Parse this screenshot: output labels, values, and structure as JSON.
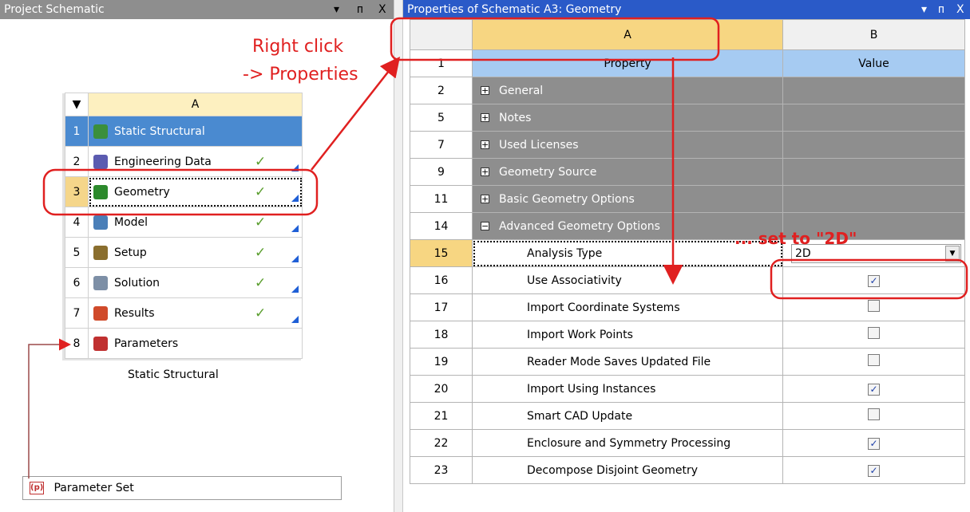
{
  "left_pane": {
    "title": "Project Schematic",
    "controls": {
      "menu": "▾",
      "pin": "ᴨ",
      "close": "X"
    },
    "system": {
      "dropdown_glyph": "▼",
      "column_header": "A",
      "caption": "Static Structural",
      "rows": [
        {
          "num": "1",
          "label": "Static Structural",
          "icon": "static-structural-icon",
          "icon_color": "#3b8f3b",
          "check": "",
          "corner": false
        },
        {
          "num": "2",
          "label": "Engineering Data",
          "icon": "engineering-data-icon",
          "icon_color": "#5b5bb0",
          "check": "✓",
          "corner": true
        },
        {
          "num": "3",
          "label": "Geometry",
          "icon": "geometry-dm-icon",
          "icon_color": "#2c8a2c",
          "check": "✓",
          "corner": true
        },
        {
          "num": "4",
          "label": "Model",
          "icon": "model-icon",
          "icon_color": "#4a7fb8",
          "check": "✓",
          "corner": true
        },
        {
          "num": "5",
          "label": "Setup",
          "icon": "setup-icon",
          "icon_color": "#8a6e2e",
          "check": "✓",
          "corner": true
        },
        {
          "num": "6",
          "label": "Solution",
          "icon": "solution-icon",
          "icon_color": "#7d8fa6",
          "check": "✓",
          "corner": true
        },
        {
          "num": "7",
          "label": "Results",
          "icon": "results-icon",
          "icon_color": "#d04a2a",
          "check": "✓",
          "corner": true
        },
        {
          "num": "8",
          "label": "Parameters",
          "icon": "parameters-icon",
          "icon_color": "#c03030",
          "check": "",
          "corner": false
        }
      ]
    },
    "parameter_set": {
      "label": "Parameter Set",
      "icon": "parameter-set-icon"
    }
  },
  "right_pane": {
    "title": "Properties of Schematic A3: Geometry",
    "controls": {
      "menu": "▾",
      "pin": "ᴨ",
      "close": "X"
    },
    "col_letters": {
      "a": "A",
      "b": "B"
    },
    "header_row": {
      "num": "1",
      "property": "Property",
      "value": "Value"
    },
    "categories": [
      {
        "num": "2",
        "label": "General",
        "expander": "+"
      },
      {
        "num": "5",
        "label": "Notes",
        "expander": "+"
      },
      {
        "num": "7",
        "label": "Used Licenses",
        "expander": "+"
      },
      {
        "num": "9",
        "label": "Geometry Source",
        "expander": "+"
      },
      {
        "num": "11",
        "label": "Basic Geometry Options",
        "expander": "+"
      },
      {
        "num": "14",
        "label": "Advanced Geometry Options",
        "expander": "−"
      }
    ],
    "analysis_type": {
      "num": "15",
      "label": "Analysis Type",
      "value": "2D",
      "arrow": "▼"
    },
    "properties": [
      {
        "num": "16",
        "label": "Use Associativity",
        "checked": true
      },
      {
        "num": "17",
        "label": "Import Coordinate Systems",
        "checked": false
      },
      {
        "num": "18",
        "label": "Import Work Points",
        "checked": false
      },
      {
        "num": "19",
        "label": "Reader Mode Saves Updated File",
        "checked": false
      },
      {
        "num": "20",
        "label": "Import Using Instances",
        "checked": true
      },
      {
        "num": "21",
        "label": "Smart CAD Update",
        "checked": false
      },
      {
        "num": "22",
        "label": "Enclosure and Symmetry Processing",
        "checked": true
      },
      {
        "num": "23",
        "label": "Decompose Disjoint Geometry",
        "checked": true
      }
    ]
  },
  "annotations": {
    "right_click": "Right click",
    "properties": "-> Properties",
    "set_2d": "... set to \"2D\"",
    "color": "#e02020"
  }
}
